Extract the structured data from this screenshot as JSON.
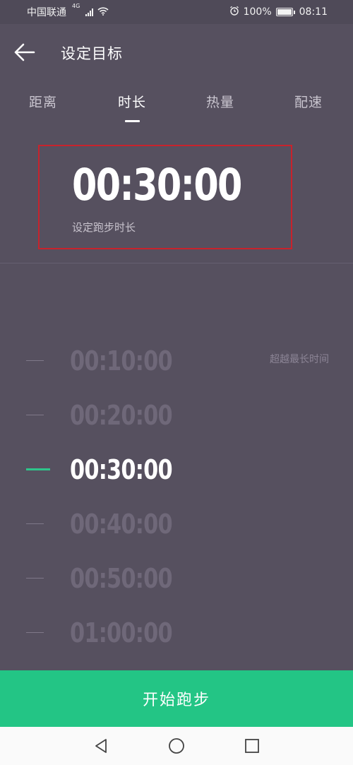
{
  "status_bar": {
    "carrier": "中国联通",
    "network": "4G",
    "battery": "100%",
    "time": "08:11",
    "icons": [
      "signal-icon",
      "wifi-icon",
      "alarm-icon",
      "battery-icon"
    ]
  },
  "header": {
    "back_icon": "arrow-left-icon",
    "title": "设定目标"
  },
  "tabs": [
    {
      "label": "距离",
      "active": false
    },
    {
      "label": "时长",
      "active": true
    },
    {
      "label": "热量",
      "active": false
    },
    {
      "label": "配速",
      "active": false
    }
  ],
  "target": {
    "value": "00:30:00",
    "subtitle": "设定跑步时长"
  },
  "picker": {
    "options": [
      "00:10:00",
      "00:20:00",
      "00:30:00",
      "00:40:00",
      "00:50:00",
      "01:00:00"
    ],
    "selected": "00:30:00",
    "exceed_label": "超越最长时间"
  },
  "start_button": {
    "label": "开始跑步",
    "color": "#23c585"
  },
  "nav_bar": {
    "buttons": [
      "back-triangle-icon",
      "home-circle-icon",
      "recents-square-icon"
    ]
  },
  "colors": {
    "background": "#56505f",
    "accent": "#2ec58b",
    "highlight_border": "#c8232c"
  }
}
